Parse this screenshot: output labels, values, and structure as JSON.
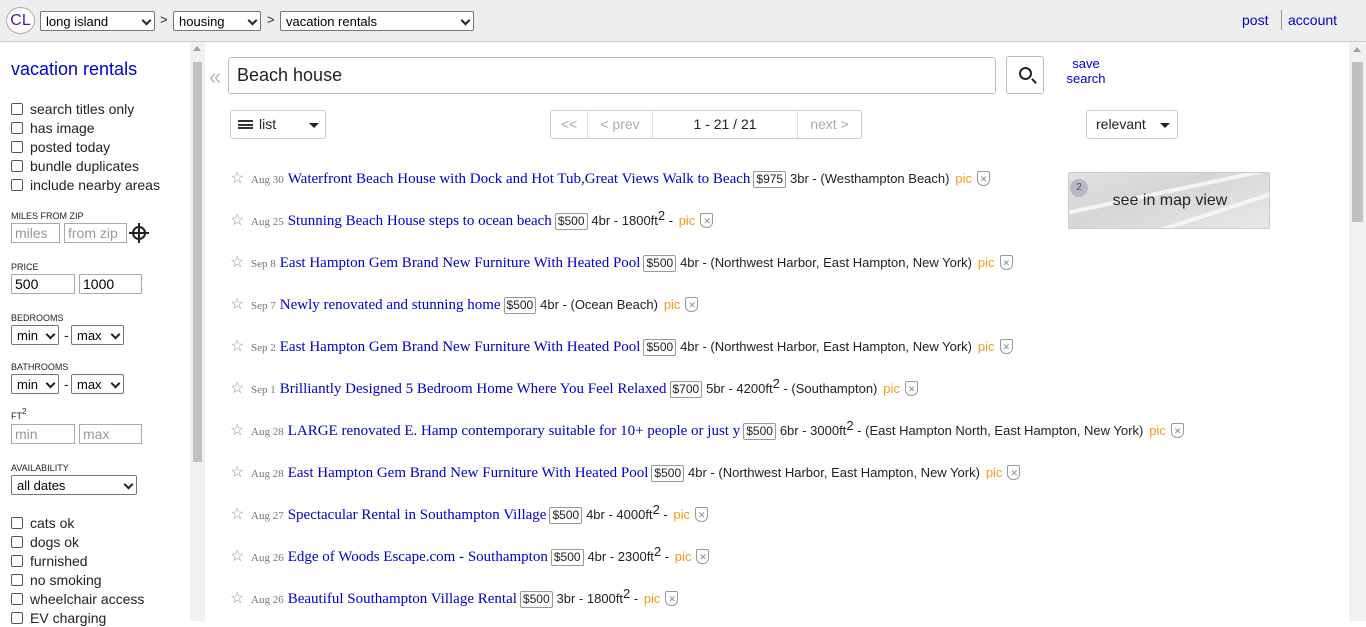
{
  "topbar": {
    "logo": "CL",
    "area": "long island",
    "category": "housing",
    "subcategory": "vacation rentals",
    "separator": ">",
    "post": "post",
    "account": "account"
  },
  "sidebar": {
    "title": "vacation rentals",
    "checkboxes": [
      "search titles only",
      "has image",
      "posted today",
      "bundle duplicates",
      "include nearby areas"
    ],
    "miles_label": "MILES FROM ZIP",
    "miles_placeholder": "miles",
    "zip_placeholder": "from zip",
    "price_label": "PRICE",
    "price_min": "500",
    "price_max": "1000",
    "bedrooms_label": "BEDROOMS",
    "bathrooms_label": "BATHROOMS",
    "select_min": "min",
    "select_max": "max",
    "range_dash": "-",
    "ft_label": "FT",
    "ft_sup": "2",
    "ft_min_placeholder": "min",
    "ft_max_placeholder": "max",
    "availability_label": "AVAILABILITY",
    "availability_value": "all dates",
    "pet_options": [
      "cats ok",
      "dogs ok",
      "furnished",
      "no smoking",
      "wheelchair access",
      "EV charging"
    ]
  },
  "search": {
    "collapse": "«",
    "query": "Beach house",
    "save_line1": "save",
    "save_line2": "search"
  },
  "toolbar": {
    "view": "list",
    "pager_first": "<<",
    "pager_prev": "< prev",
    "pager_range": "1 - 21 / 21",
    "pager_next": "next >",
    "sort": "relevant",
    "map_view": "see in map view"
  },
  "results": [
    {
      "date": "Aug 30",
      "title": "Waterfront Beach House with Dock and Hot Tub,Great Views Walk to Beach",
      "price": "$975",
      "details": "3br",
      "sqft": "",
      "location": "(Westhampton Beach)",
      "pic": "pic"
    },
    {
      "date": "Aug 25",
      "title": "Stunning Beach House steps to ocean beach",
      "price": "$500",
      "details": "4br - 1800ft",
      "sqft": "2",
      "location": "",
      "pic": "pic"
    },
    {
      "date": "Sep 8",
      "title": "East Hampton Gem Brand New Furniture With Heated Pool",
      "price": "$500",
      "details": "4br",
      "sqft": "",
      "location": "(Northwest Harbor, East Hampton, New York)",
      "pic": "pic"
    },
    {
      "date": "Sep 7",
      "title": "Newly renovated and stunning home",
      "price": "$500",
      "details": "4br",
      "sqft": "",
      "location": "(Ocean Beach)",
      "pic": "pic"
    },
    {
      "date": "Sep 2",
      "title": "East Hampton Gem Brand New Furniture With Heated Pool",
      "price": "$500",
      "details": "4br",
      "sqft": "",
      "location": "(Northwest Harbor, East Hampton, New York)",
      "pic": "pic"
    },
    {
      "date": "Sep 1",
      "title": "Brilliantly Designed 5 Bedroom Home Where You Feel Relaxed",
      "price": "$700",
      "details": "5br - 4200ft",
      "sqft": "2",
      "location": "(Southampton)",
      "pic": "pic"
    },
    {
      "date": "Aug 28",
      "title": "LARGE renovated E. Hamp contemporary suitable for 10+ people or just y",
      "price": "$500",
      "details": "6br - 3000ft",
      "sqft": "2",
      "location": "(East Hampton North, East Hampton, New York)",
      "pic": "pic"
    },
    {
      "date": "Aug 28",
      "title": "East Hampton Gem Brand New Furniture With Heated Pool",
      "price": "$500",
      "details": "4br",
      "sqft": "",
      "location": "(Northwest Harbor, East Hampton, New York)",
      "pic": "pic"
    },
    {
      "date": "Aug 27",
      "title": "Spectacular Rental in Southampton Village",
      "price": "$500",
      "details": "4br - 4000ft",
      "sqft": "2",
      "location": "",
      "pic": "pic"
    },
    {
      "date": "Aug 26",
      "title": "Edge of Woods Escape.com - Southampton",
      "price": "$500",
      "details": "4br - 2300ft",
      "sqft": "2",
      "location": "",
      "pic": "pic"
    },
    {
      "date": "Aug 26",
      "title": "Beautiful Southampton Village Rental",
      "price": "$500",
      "details": "3br - 1800ft",
      "sqft": "2",
      "location": "",
      "pic": "pic"
    }
  ],
  "icons": {
    "star": "star-icon",
    "ban": "hide-icon",
    "search": "search-icon",
    "target": "crosshair-icon"
  },
  "colors": {
    "link": "#0000cc",
    "pic": "#f39c12",
    "topbar": "#eeeeee"
  }
}
